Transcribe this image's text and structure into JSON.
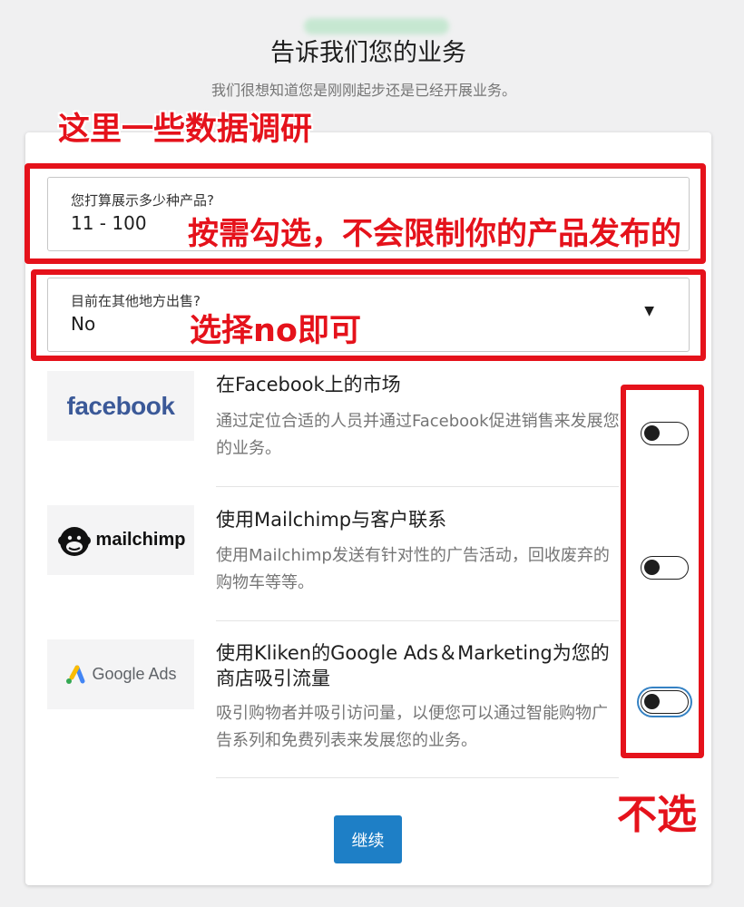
{
  "header": {
    "title": "告诉我们您的业务",
    "subtitle": "我们很想知道您是刚刚起步还是已经开展业务。"
  },
  "form": {
    "products": {
      "label": "您打算展示多少种产品?",
      "value": "11 - 100"
    },
    "selling_elsewhere": {
      "label": "目前在其他地方出售?",
      "value": "No"
    }
  },
  "features": [
    {
      "logo": "facebook",
      "title": "在Facebook上的市场",
      "description": "通过定位合适的人员并通过Facebook促进销售来发展您的业务。",
      "enabled": false
    },
    {
      "logo": "mailchimp",
      "title": "使用Mailchimp与客户联系",
      "description": "使用Mailchimp发送有针对性的广告活动，回收废弃的购物车等等。",
      "enabled": false
    },
    {
      "logo": "Google Ads",
      "title": "使用Kliken的Google Ads＆Marketing为您的商店吸引流量",
      "description": "吸引购物者并吸引访问量，以便您可以通过智能购物广告系列和免费列表来发展您的业务。",
      "enabled": false
    }
  ],
  "actions": {
    "continue_label": "继续"
  },
  "annotations": {
    "survey_note": "这里一些数据调研",
    "products_note": "按需勾选，不会限制你的产品发布的",
    "selling_note": "选择no即可",
    "toggles_note": "不选"
  },
  "colors": {
    "annotation": "#e5121b",
    "primary": "#1e7fc6",
    "facebook": "#3b5998"
  }
}
